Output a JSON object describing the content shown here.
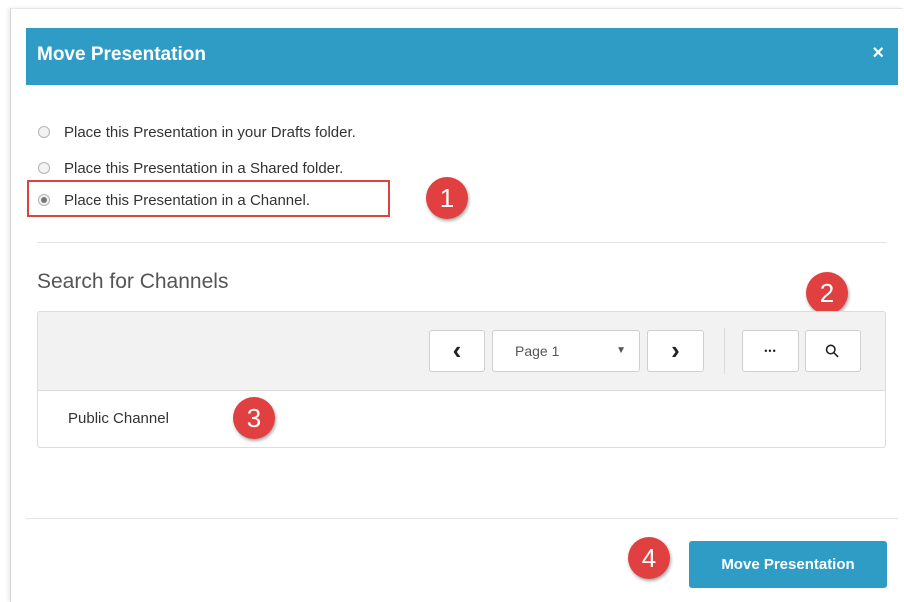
{
  "dialog": {
    "title": "Move Presentation",
    "close_symbol": "×",
    "options": [
      {
        "label": "Place this Presentation in your Drafts folder.",
        "selected": false
      },
      {
        "label": "Place this Presentation in a Shared folder.",
        "selected": false
      },
      {
        "label": "Place this Presentation in a Channel.",
        "selected": true
      }
    ],
    "search_title": "Search for Channels",
    "pager": {
      "prev_symbol": "‹",
      "next_symbol": "›",
      "page_label": "Page 1",
      "dropdown_symbol": "▼",
      "more_symbol": "•••",
      "search_symbol": "⚲"
    },
    "results": [
      "Public Channel"
    ],
    "submit_label": "Move Presentation"
  },
  "badges": [
    "1",
    "2",
    "3",
    "4"
  ],
  "colors": {
    "accent": "#2f9cc6",
    "badge": "#e0403f",
    "highlight_border": "#d9443f"
  }
}
